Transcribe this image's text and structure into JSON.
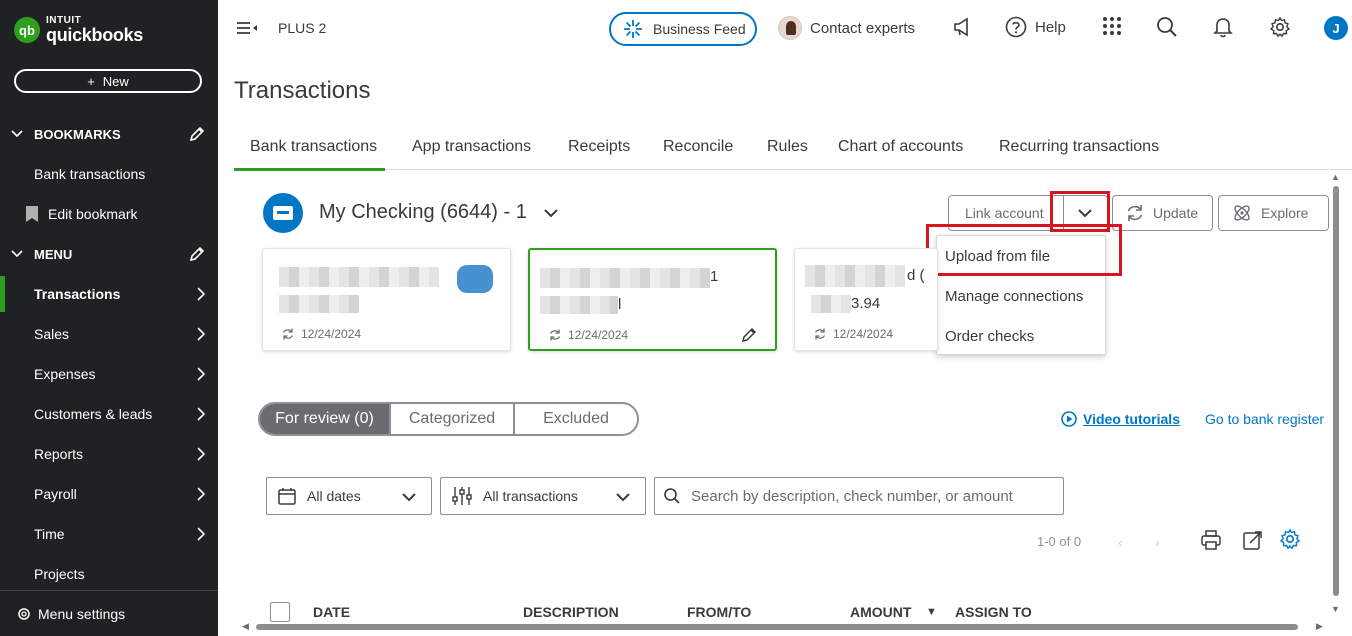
{
  "brand": {
    "intuit": "INTUIT",
    "name": "quickbooks",
    "badge": "qb"
  },
  "sidebar": {
    "new_label": "New",
    "bookmarks_header": "BOOKMARKS",
    "bookmarks": [
      {
        "label": "Bank transactions"
      },
      {
        "label": "Edit bookmark"
      }
    ],
    "menu_header": "MENU",
    "items": [
      {
        "label": "Transactions"
      },
      {
        "label": "Sales"
      },
      {
        "label": "Expenses"
      },
      {
        "label": "Customers & leads"
      },
      {
        "label": "Reports"
      },
      {
        "label": "Payroll"
      },
      {
        "label": "Time"
      },
      {
        "label": "Projects"
      }
    ],
    "menu_settings": "Menu settings"
  },
  "topbar": {
    "plan": "PLUS 2",
    "business_feed": "Business Feed",
    "contact_experts": "Contact experts",
    "help": "Help",
    "user_initial": "J"
  },
  "page": {
    "title": "Transactions",
    "tabs": [
      {
        "label": "Bank transactions"
      },
      {
        "label": "App transactions"
      },
      {
        "label": "Receipts"
      },
      {
        "label": "Reconcile"
      },
      {
        "label": "Rules"
      },
      {
        "label": "Chart of accounts"
      },
      {
        "label": "Recurring transactions"
      }
    ]
  },
  "account": {
    "name": "My Checking (6644) - 1",
    "link_account": "Link account",
    "update": "Update",
    "explore": "Explore",
    "dropdown": [
      {
        "label": "Upload from file"
      },
      {
        "label": "Manage connections"
      },
      {
        "label": "Order checks"
      }
    ],
    "cards": [
      {
        "date": "12/24/2024"
      },
      {
        "date": "12/24/2024",
        "partial_text_1": "1",
        "partial_text_2": "l"
      },
      {
        "date": "12/24/2024",
        "partial_text_1": "d (",
        "partial_text_2": "3.94"
      }
    ]
  },
  "review": {
    "segments": [
      {
        "label": "For review (0)"
      },
      {
        "label": "Categorized"
      },
      {
        "label": "Excluded"
      }
    ],
    "video_tutorials": "Video tutorials",
    "bank_register": "Go to bank register"
  },
  "filters": {
    "dates": "All dates",
    "transactions": "All transactions",
    "search_placeholder": "Search by description, check number, or amount"
  },
  "pager": {
    "text": "1-0 of 0"
  },
  "table": {
    "columns": [
      {
        "label": "DATE"
      },
      {
        "label": "DESCRIPTION"
      },
      {
        "label": "FROM/TO"
      },
      {
        "label": "AMOUNT"
      },
      {
        "label": "ASSIGN TO"
      }
    ]
  },
  "colors": {
    "brand_green": "#2ca01c",
    "accent_blue": "#0077c5",
    "sidebar_bg": "#1f2123",
    "highlight_red": "#d9141e"
  }
}
